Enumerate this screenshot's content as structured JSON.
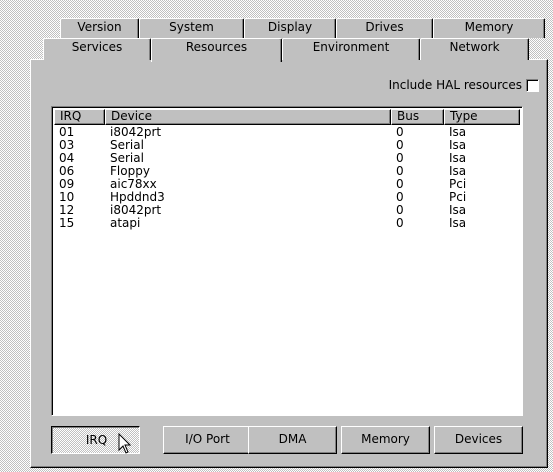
{
  "tabs": {
    "row_top": [
      {
        "label": "Version",
        "selected": false
      },
      {
        "label": "System",
        "selected": false
      },
      {
        "label": "Display",
        "selected": false
      },
      {
        "label": "Drives",
        "selected": false
      },
      {
        "label": "Memory",
        "selected": false
      }
    ],
    "row_bottom": [
      {
        "label": "Services",
        "selected": false
      },
      {
        "label": "Resources",
        "selected": true
      },
      {
        "label": "Environment",
        "selected": false
      },
      {
        "label": "Network",
        "selected": false
      }
    ]
  },
  "hal": {
    "label": "Include HAL resources",
    "checked": false
  },
  "list": {
    "columns": [
      "IRQ",
      "Device",
      "Bus",
      "Type"
    ],
    "rows": [
      [
        "01",
        "i8042prt",
        "0",
        "Isa"
      ],
      [
        "03",
        "Serial",
        "0",
        "Isa"
      ],
      [
        "04",
        "Serial",
        "0",
        "Isa"
      ],
      [
        "06",
        "Floppy",
        "0",
        "Isa"
      ],
      [
        "09",
        "aic78xx",
        "0",
        "Pci"
      ],
      [
        "10",
        "Hpddnd3",
        "0",
        "Pci"
      ],
      [
        "12",
        "i8042prt",
        "0",
        "Isa"
      ],
      [
        "15",
        "atapi",
        "0",
        "Isa"
      ]
    ]
  },
  "buttons": [
    {
      "label": "IRQ",
      "pressed": true
    },
    {
      "label": "I/O Port",
      "pressed": false
    },
    {
      "label": "DMA",
      "pressed": false
    },
    {
      "label": "Memory",
      "pressed": false
    },
    {
      "label": "Devices",
      "pressed": false
    }
  ],
  "cursor": {
    "icon": "arrow-cursor-icon"
  }
}
